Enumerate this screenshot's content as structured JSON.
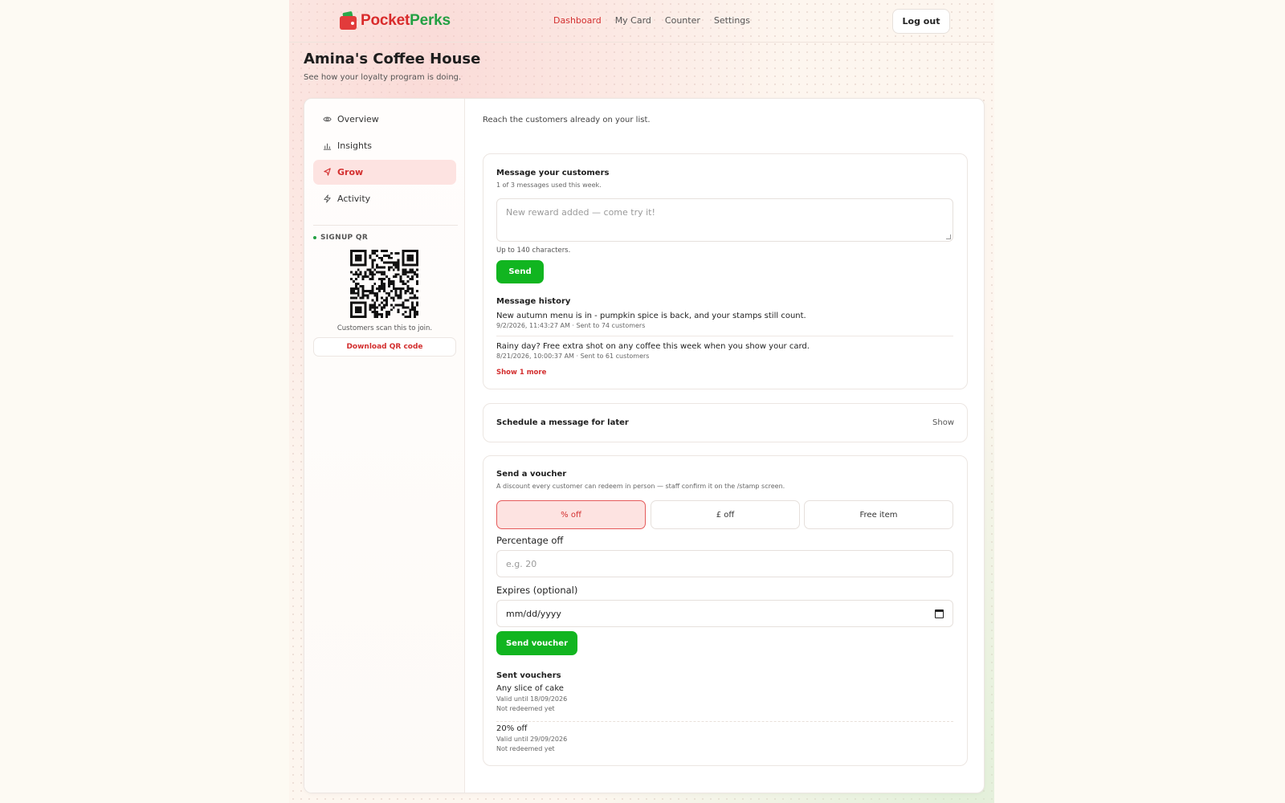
{
  "brand": {
    "part1": "Pocket",
    "part2": "Perks"
  },
  "nav": {
    "links": [
      "Dashboard",
      "My Card",
      "Counter",
      "Settings"
    ],
    "active": "Dashboard",
    "logout": "Log out"
  },
  "header": {
    "title": "Amina's Coffee House",
    "subtitle": "See how your loyalty program is doing."
  },
  "sidebar": {
    "items": [
      {
        "label": "Overview",
        "icon": "eye-icon"
      },
      {
        "label": "Insights",
        "icon": "bar-chart-icon"
      },
      {
        "label": "Grow",
        "icon": "megaphone-icon",
        "active": true
      },
      {
        "label": "Activity",
        "icon": "lightning-icon"
      }
    ],
    "qr": {
      "label": "SIGNUP QR",
      "caption": "Customers scan this to join.",
      "download": "Download QR code"
    }
  },
  "grow": {
    "intro": "Reach the customers already on your list.",
    "message": {
      "title": "Message your customers",
      "usage": "1 of 3 messages used this week.",
      "placeholder": "New reward added — come try it!",
      "hint": "Up to 140 characters.",
      "send": "Send",
      "history_title": "Message history",
      "history": [
        {
          "text": "New autumn menu is in - pumpkin spice is back, and your stamps still count.",
          "meta": "9/2/2026, 11:43:27 AM · Sent to 74 customers"
        },
        {
          "text": "Rainy day? Free extra shot on any coffee this week when you show your card.",
          "meta": "8/21/2026, 10:00:37 AM · Sent to 61 customers"
        }
      ],
      "show_more": "Show 1 more"
    },
    "schedule": {
      "title": "Schedule a message for later",
      "toggle": "Show"
    },
    "voucher": {
      "title": "Send a voucher",
      "subtitle": "A discount every customer can redeem in person — staff confirm it on the /stamp screen.",
      "types": [
        "% off",
        "£ off",
        "Free item"
      ],
      "selected_type": "% off",
      "percent_label": "Percentage off",
      "percent_placeholder": "e.g. 20",
      "expires_label": "Expires (optional)",
      "expires_value": "mm/dd/yyyy",
      "send": "Send voucher",
      "sent_title": "Sent vouchers",
      "sent": [
        {
          "name": "Any slice of cake",
          "valid": "Valid until 18/09/2026",
          "status": "Not redeemed yet"
        },
        {
          "name": "20% off",
          "valid": "Valid until 29/09/2026",
          "status": "Not redeemed yet"
        }
      ]
    }
  },
  "colors": {
    "accent": "#d32f2f",
    "green": "#11b520",
    "active_bg": "#fde3e1"
  }
}
